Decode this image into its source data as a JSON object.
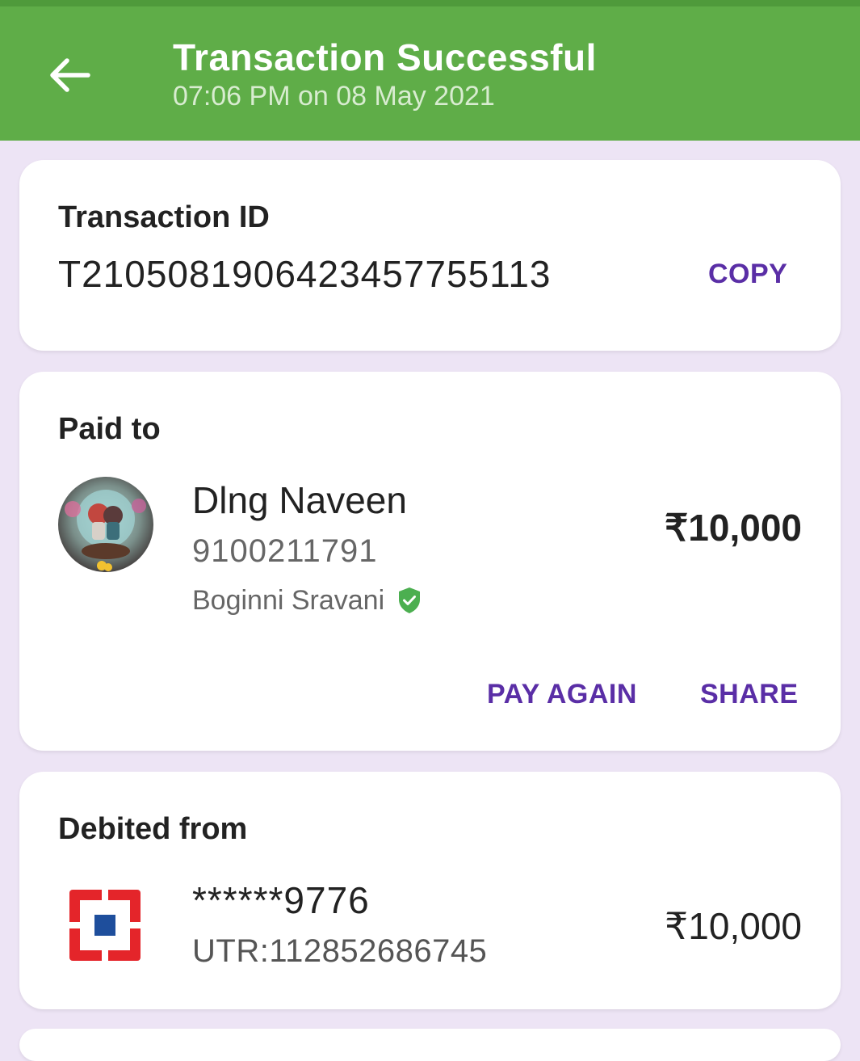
{
  "header": {
    "title": "Transaction Successful",
    "subtitle": "07:06 PM on 08 May 2021"
  },
  "transaction": {
    "label": "Transaction ID",
    "id": "T2105081906423457755113",
    "copy_label": "COPY"
  },
  "paid_to": {
    "label": "Paid to",
    "name": "Dlng Naveen",
    "phone": "9100211791",
    "bank_name": "Boginni Sravani",
    "amount": "₹10,000",
    "pay_again_label": "PAY AGAIN",
    "share_label": "SHARE"
  },
  "debited_from": {
    "label": "Debited from",
    "account": "******9776",
    "utr": "UTR:112852686745",
    "amount": "₹10,000"
  },
  "colors": {
    "header_green": "#5fad48",
    "accent_purple": "#5a2ea6",
    "background": "#ede4f5",
    "verified_green": "#4caf50",
    "bank_red": "#e4252a",
    "bank_blue": "#1e4e9c"
  },
  "icons": {
    "back": "arrow-left-icon",
    "verified": "verified-shield-icon",
    "bank": "hdfc-bank-logo-icon"
  }
}
